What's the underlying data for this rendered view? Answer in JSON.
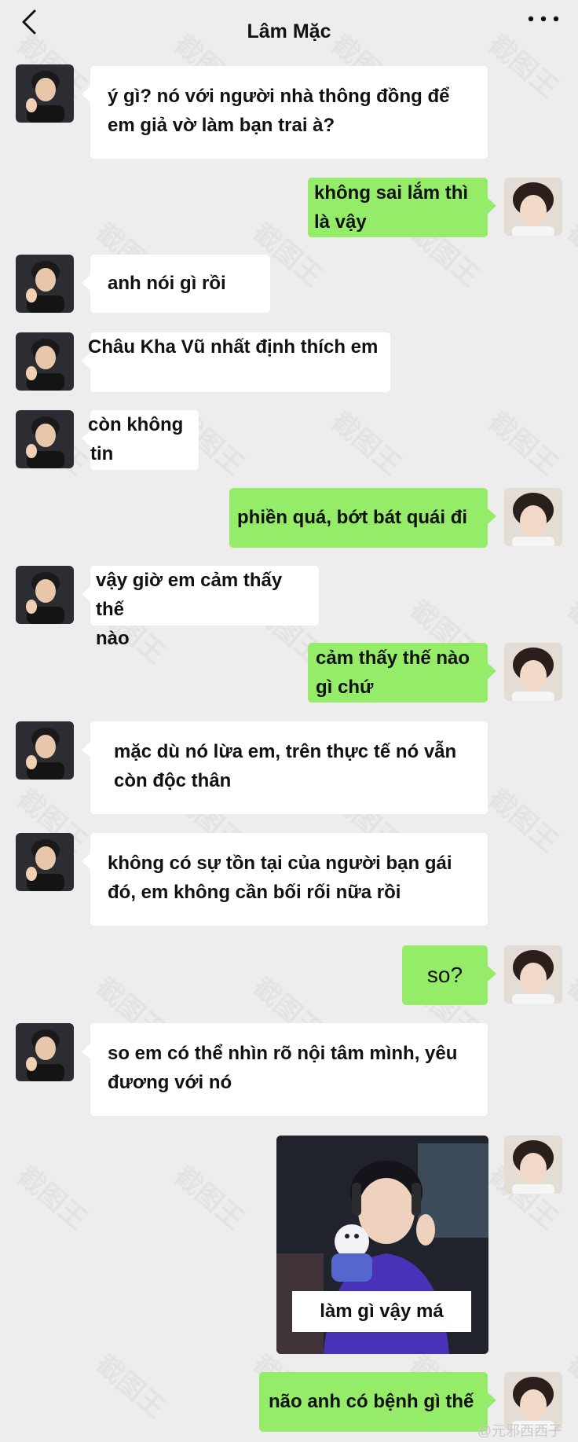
{
  "header": {
    "title": "Lâm Mặc",
    "back_icon": "chevron-left-icon",
    "more_icon": "more-dots-icon"
  },
  "messages": [
    {
      "side": "left",
      "lines": [
        "ý gì? nó với người nhà thông đồng để",
        "em giả vờ làm bạn trai à?"
      ]
    },
    {
      "side": "right",
      "lines": [
        "không sai lắm thì",
        "là vậy"
      ]
    },
    {
      "side": "left",
      "lines": [
        "anh nói gì rồi"
      ]
    },
    {
      "side": "left",
      "lines": [
        "Châu Kha Vũ nhất định thích em"
      ]
    },
    {
      "side": "left",
      "lines": [
        "còn không tin"
      ]
    },
    {
      "side": "right",
      "lines": [
        "phiền quá, bớt bát quái đi"
      ]
    },
    {
      "side": "left",
      "lines": [
        "vậy giờ em cảm thấy thế",
        "nào"
      ]
    },
    {
      "side": "right",
      "lines": [
        "cảm thấy thế nào",
        "gì chứ"
      ]
    },
    {
      "side": "left",
      "lines": [
        "mặc dù nó lừa em, trên thực tế nó vẫn",
        "còn độc thân"
      ]
    },
    {
      "side": "left",
      "lines": [
        "không có sự tồn tại của người bạn gái",
        "đó, em không cần bối rối nữa rồi"
      ]
    },
    {
      "side": "right",
      "lines": [
        "so?"
      ]
    },
    {
      "side": "left",
      "lines": [
        "so em có thể nhìn rõ nội tâm mình, yêu",
        "đương với nó"
      ]
    },
    {
      "side": "right",
      "type": "image",
      "caption": "làm gì vậy má"
    },
    {
      "side": "right",
      "lines": [
        "não anh có bệnh gì thế"
      ]
    }
  ],
  "watermark": "@元邪西西子",
  "bg_watermark": "截图王",
  "colors": {
    "background": "#ededed",
    "bubble_left": "#ffffff",
    "bubble_right": "#95ec69"
  }
}
